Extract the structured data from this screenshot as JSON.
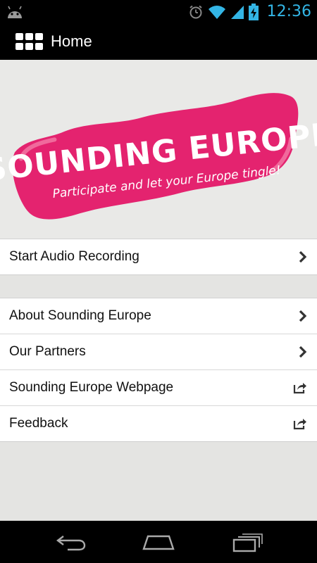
{
  "status_bar": {
    "time": "12:36",
    "icons": [
      "android-debug-icon",
      "alarm-icon",
      "wifi-icon",
      "signal-icon",
      "battery-charging-icon"
    ]
  },
  "action_bar": {
    "icon": "app-grid-icon",
    "title": "Home"
  },
  "banner": {
    "logo_title": "SOUNDING EUROPE",
    "logo_tagline": "Participate and let your Europe tingle!",
    "brand_color": "#e4236f"
  },
  "menu": {
    "group1": [
      {
        "label": "Start Audio Recording",
        "icon": "chevron-right-icon"
      }
    ],
    "group2": [
      {
        "label": "About Sounding Europe",
        "icon": "chevron-right-icon"
      },
      {
        "label": "Our Partners",
        "icon": "chevron-right-icon"
      },
      {
        "label": "Sounding Europe Webpage",
        "icon": "share-external-icon"
      },
      {
        "label": "Feedback",
        "icon": "share-external-icon"
      }
    ]
  },
  "nav_bar": {
    "buttons": [
      "back-icon",
      "home-icon",
      "recent-apps-icon"
    ]
  },
  "colors": {
    "status_accent": "#33b5e5",
    "bar_background": "#000000"
  }
}
